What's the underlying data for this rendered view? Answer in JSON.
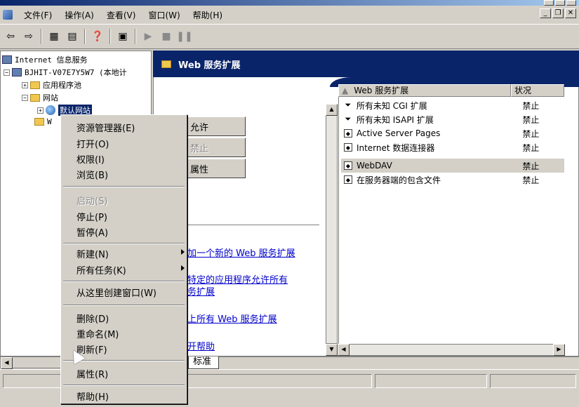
{
  "menubar": {
    "items": [
      "文件(F)",
      "操作(A)",
      "查看(V)",
      "窗口(W)",
      "帮助(H)"
    ]
  },
  "mdi_buttons": [
    "_",
    "❐",
    "✕"
  ],
  "toolbar": {
    "icons": [
      "back-icon",
      "forward-icon",
      "show-tree-icon",
      "export-icon",
      "help-icon",
      "computer-icon",
      "play-icon",
      "stop-icon",
      "pause-icon"
    ]
  },
  "tree": {
    "root": "Internet 信息服务",
    "computer": "BJHIT-V07E7Y5W7 (本地计",
    "app_pools": "应用程序池",
    "websites": "网站",
    "default_site": "默认网站",
    "web_ext_short": "W"
  },
  "right": {
    "banner_title": "Web 服务扩展",
    "buttons": {
      "allow": "允许",
      "prohibit": "禁止",
      "properties": "属性"
    },
    "links": [
      "加一个新的 Web 服务扩展",
      "特定的应用程序允许所有",
      "务扩展",
      "上所有 Web 服务扩展",
      "开帮助"
    ],
    "tab_standard": "标准"
  },
  "list": {
    "columns": [
      "Web 服务扩展",
      "状况"
    ],
    "rows": [
      {
        "name": "所有未知 CGI 扩展",
        "status": "禁止",
        "icon": "filter-icon"
      },
      {
        "name": "所有未知 ISAPI 扩展",
        "status": "禁止",
        "icon": "filter-icon"
      },
      {
        "name": "Active Server Pages",
        "status": "禁止",
        "icon": "extension-icon"
      },
      {
        "name": "Internet 数据连接器",
        "status": "禁止",
        "icon": "extension-icon"
      },
      {
        "name": "WebDAV",
        "status": "禁止",
        "icon": "extension-icon"
      },
      {
        "name": "在服务器端的包含文件",
        "status": "禁止",
        "icon": "extension-icon"
      }
    ]
  },
  "context_menu": {
    "explorer": "资源管理器(E)",
    "open": "打开(O)",
    "permissions": "权限(I)",
    "browse": "浏览(B)",
    "start": "启动(S)",
    "stop": "停止(P)",
    "pause": "暂停(A)",
    "new": "新建(N)",
    "all_tasks": "所有任务(K)",
    "new_window": "从这里创建窗口(W)",
    "delete": "删除(D)",
    "rename": "重命名(M)",
    "refresh": "刷新(F)",
    "properties": "属性(R)",
    "help": "帮助(H)"
  }
}
